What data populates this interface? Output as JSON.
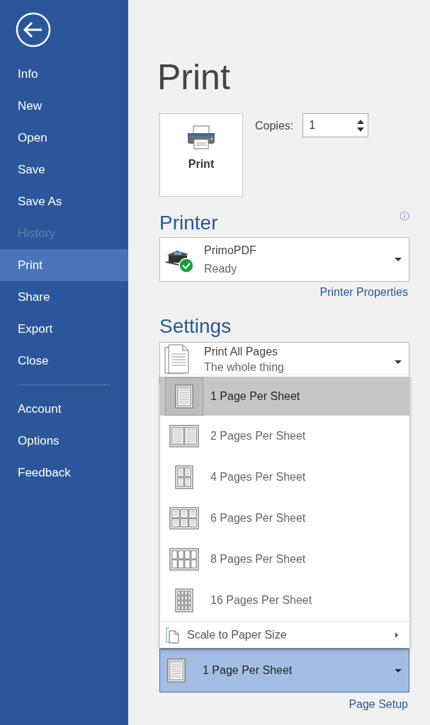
{
  "sidebar": {
    "groups": [
      [
        {
          "label": "Info",
          "selected": false,
          "disabled": false
        },
        {
          "label": "New",
          "selected": false,
          "disabled": false
        },
        {
          "label": "Open",
          "selected": false,
          "disabled": false
        },
        {
          "label": "Save",
          "selected": false,
          "disabled": false
        },
        {
          "label": "Save As",
          "selected": false,
          "disabled": false
        },
        {
          "label": "History",
          "selected": false,
          "disabled": true
        },
        {
          "label": "Print",
          "selected": true,
          "disabled": false
        },
        {
          "label": "Share",
          "selected": false,
          "disabled": false
        },
        {
          "label": "Export",
          "selected": false,
          "disabled": false
        },
        {
          "label": "Close",
          "selected": false,
          "disabled": false
        }
      ],
      [
        {
          "label": "Account",
          "selected": false,
          "disabled": false
        },
        {
          "label": "Options",
          "selected": false,
          "disabled": false
        },
        {
          "label": "Feedback",
          "selected": false,
          "disabled": false
        }
      ]
    ]
  },
  "title": "Print",
  "print_button": {
    "label": "Print"
  },
  "copies": {
    "label": "Copies:",
    "value": "1"
  },
  "printer": {
    "heading": "Printer",
    "name": "PrimoPDF",
    "status": "Ready",
    "properties_link": "Printer Properties"
  },
  "settings": {
    "heading": "Settings",
    "pages": {
      "title": "Print All Pages",
      "subtitle": "The whole thing"
    },
    "per_sheet": {
      "label": "1 Page Per Sheet",
      "expanded": true,
      "menu": [
        {
          "label": "1 Page Per Sheet",
          "selected": true
        },
        {
          "label": "2 Pages Per Sheet",
          "selected": false
        },
        {
          "label": "4 Pages Per Sheet",
          "selected": false
        },
        {
          "label": "6 Pages Per Sheet",
          "selected": false
        },
        {
          "label": "8 Pages Per Sheet",
          "selected": false
        },
        {
          "label": "16 Pages Per Sheet",
          "selected": false
        }
      ],
      "scale": {
        "label": "Scale to Paper Size"
      }
    }
  },
  "page_setup": "Page Setup"
}
